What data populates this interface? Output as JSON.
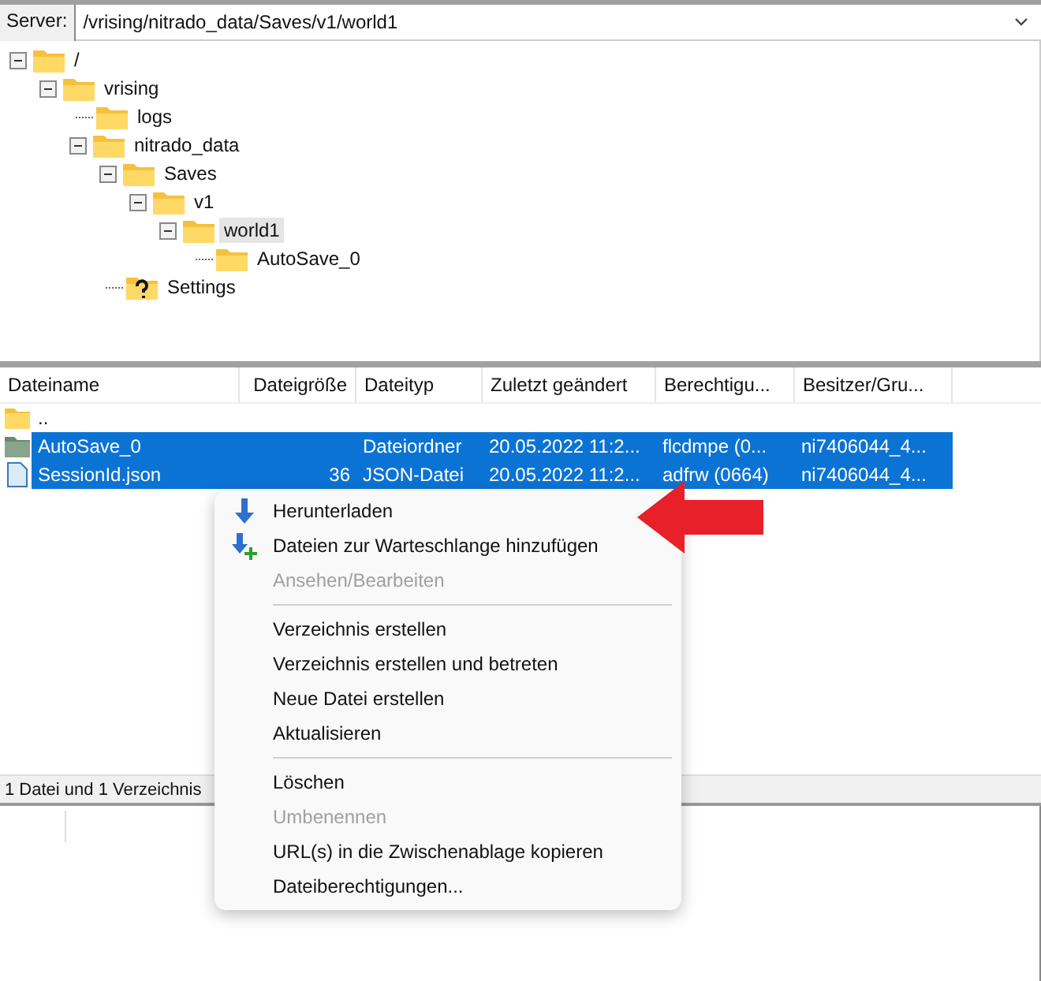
{
  "server": {
    "label": "Server:",
    "path": "/vrising/nitrado_data/Saves/v1/world1"
  },
  "tree": [
    {
      "name": "/",
      "kind": "folder",
      "expanded": true,
      "selected": false,
      "children": [
        {
          "name": "vrising",
          "kind": "folder",
          "expanded": true,
          "selected": false,
          "children": [
            {
              "name": "logs",
              "kind": "folder",
              "selected": false
            },
            {
              "name": "nitrado_data",
              "kind": "folder",
              "expanded": true,
              "selected": false,
              "children": [
                {
                  "name": "Saves",
                  "kind": "folder",
                  "expanded": true,
                  "selected": false,
                  "children": [
                    {
                      "name": "v1",
                      "kind": "folder",
                      "expanded": true,
                      "selected": false,
                      "children": [
                        {
                          "name": "world1",
                          "kind": "folder",
                          "expanded": true,
                          "selected": true,
                          "children": [
                            {
                              "name": "AutoSave_0",
                              "kind": "folder",
                              "selected": false
                            }
                          ]
                        }
                      ]
                    }
                  ]
                },
                {
                  "name": "Settings",
                  "kind": "unknown",
                  "selected": false
                }
              ]
            }
          ]
        }
      ]
    }
  ],
  "table": {
    "columns": [
      "Dateiname",
      "Dateigröße",
      "Dateityp",
      "Zuletzt geändert",
      "Berechtigu...",
      "Besitzer/Gru..."
    ],
    "rows": [
      {
        "kind": "parent",
        "selected": false,
        "cells": [
          "..",
          "",
          "",
          "",
          "",
          ""
        ]
      },
      {
        "kind": "folder",
        "selected": true,
        "cells": [
          "AutoSave_0",
          "",
          "Dateiordner",
          "20.05.2022 11:2...",
          "flcdmpe (0...",
          "ni7406044_4..."
        ]
      },
      {
        "kind": "file",
        "selected": true,
        "cells": [
          "SessionId.json",
          "36",
          "JSON-Datei",
          "20.05.2022 11:2...",
          "adfrw (0664)",
          "ni7406044_4..."
        ]
      }
    ]
  },
  "status_bar": "1 Datei und 1 Verzeichnis",
  "context_menu": [
    {
      "kind": "item",
      "label": "Herunterladen",
      "disabled": false
    },
    {
      "kind": "item",
      "label": "Dateien zur Warteschlange hinzufügen",
      "disabled": false
    },
    {
      "kind": "item",
      "label": "Ansehen/Bearbeiten",
      "disabled": true
    },
    {
      "kind": "separator"
    },
    {
      "kind": "item",
      "label": "Verzeichnis erstellen",
      "disabled": false
    },
    {
      "kind": "item",
      "label": "Verzeichnis erstellen und betreten",
      "disabled": false
    },
    {
      "kind": "item",
      "label": "Neue Datei erstellen",
      "disabled": false
    },
    {
      "kind": "item",
      "label": "Aktualisieren",
      "disabled": false
    },
    {
      "kind": "separator"
    },
    {
      "kind": "item",
      "label": "Löschen",
      "disabled": false
    },
    {
      "kind": "item",
      "label": "Umbenennen",
      "disabled": true
    },
    {
      "kind": "item",
      "label": "URL(s) in die Zwischenablage kopieren",
      "disabled": false
    },
    {
      "kind": "item",
      "label": "Dateiberechtigungen...",
      "disabled": false
    }
  ]
}
